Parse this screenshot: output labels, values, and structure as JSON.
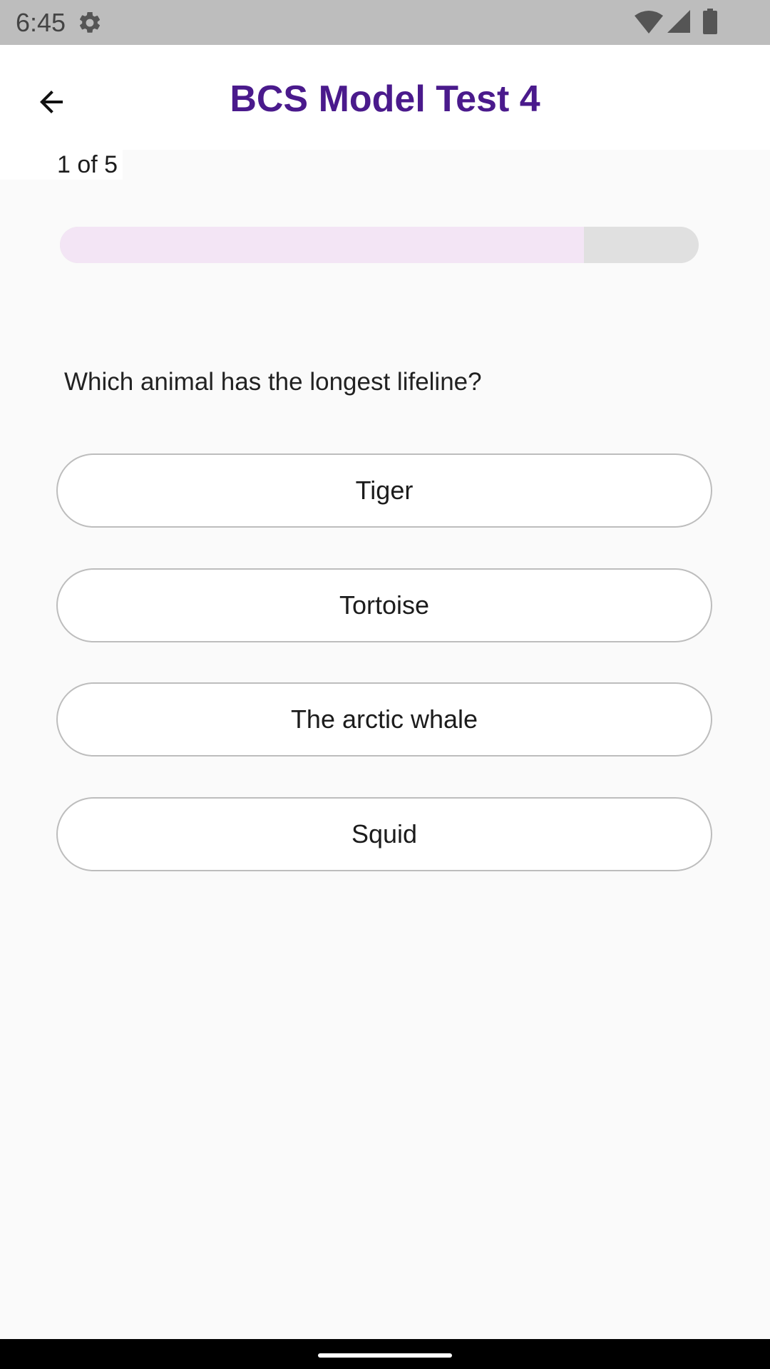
{
  "status_bar": {
    "time": "6:45",
    "icons": [
      "gear-icon",
      "wifi-icon",
      "signal-icon",
      "battery-icon"
    ]
  },
  "app_bar": {
    "title": "BCS Model Test 4",
    "back_icon": "arrow-back-icon",
    "title_color": "#4a1a8c"
  },
  "quiz": {
    "counter": "1 of 5",
    "progress_fraction": 0.82,
    "question": "Which animal has the longest lifeline?",
    "options": [
      "Tiger",
      "Tortoise",
      "The arctic whale",
      "Squid"
    ]
  },
  "colors": {
    "progress_fill": "#f3e5f5",
    "progress_track": "#e0e0e0",
    "background": "#fafafa"
  }
}
